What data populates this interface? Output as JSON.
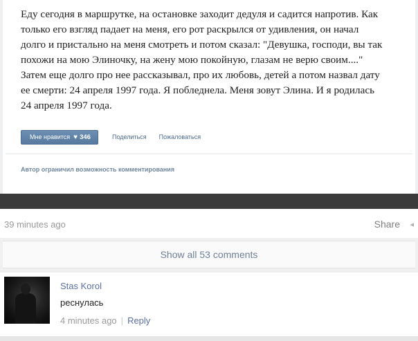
{
  "post": {
    "lines": [
      "Еду сегодня в маршрутке, на остановке заходит дедуля и садится напротив. Как",
      "только его взгляд падает на меня, его рот раскрылся от удивления, он начал",
      "долго и пристально на меня смотреть и потом сказал: \"Девушка, господи, вы так",
      "похожи на мою Элиночку, на жену мою покойную, глазам не верю своим....\"",
      "Затем еще долго про нее рассказывал, про их любовь, детей а потом назвал дату",
      "ее смерти: 24 апреля 1997 года. Я побледнела. Меня зовут Элина. И я родилась",
      "24 апреля 1997 года."
    ],
    "like_label": "Мне нравится",
    "like_icon": "heart-icon",
    "like_count": "346",
    "share_label": "Поделиться",
    "report_label": "Пожаловаться",
    "restricted_notice": "Автор ограничил возможность комментирования"
  },
  "meta": {
    "time_ago": "39 minutes ago",
    "share_label": "Share",
    "share_icon": "share-arrow-icon"
  },
  "comments_bar": {
    "label": "Show all 53 comments"
  },
  "comment": {
    "author": "Stas Korol",
    "text": "реснулась",
    "time_ago": "4 minutes ago",
    "reply_label": "Reply"
  },
  "colors": {
    "vk_button": "#5f81a7",
    "vk_link": "#4a6a8e",
    "fb_link": "#5a6fa5",
    "dark_band": "#3b3b3b"
  }
}
